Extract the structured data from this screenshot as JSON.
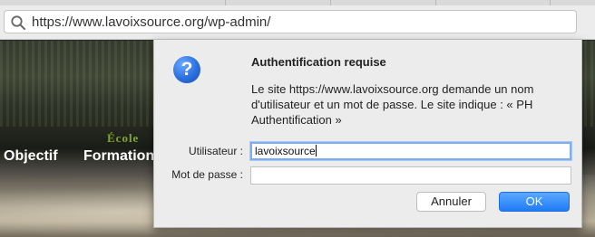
{
  "browser": {
    "url": "https://www.lavoixsource.org/wp-admin/",
    "icons": {
      "search": "search-icon"
    }
  },
  "site": {
    "school_heading": "École",
    "nav": [
      "Objectif",
      "Formation"
    ]
  },
  "dialog": {
    "title": "Authentification requise",
    "message": "Le site https://www.lavoixsource.org demande un nom d'utilisateur et un mot de passe. Le site indique : « PH Authentification »",
    "username_label": "Utilisateur :",
    "username_value": "lavoixsource",
    "password_label": "Mot de passe :",
    "password_value": "",
    "cancel_label": "Annuler",
    "ok_label": "OK",
    "icon": "help-question-icon",
    "accent_color": "#1f7bf5"
  }
}
